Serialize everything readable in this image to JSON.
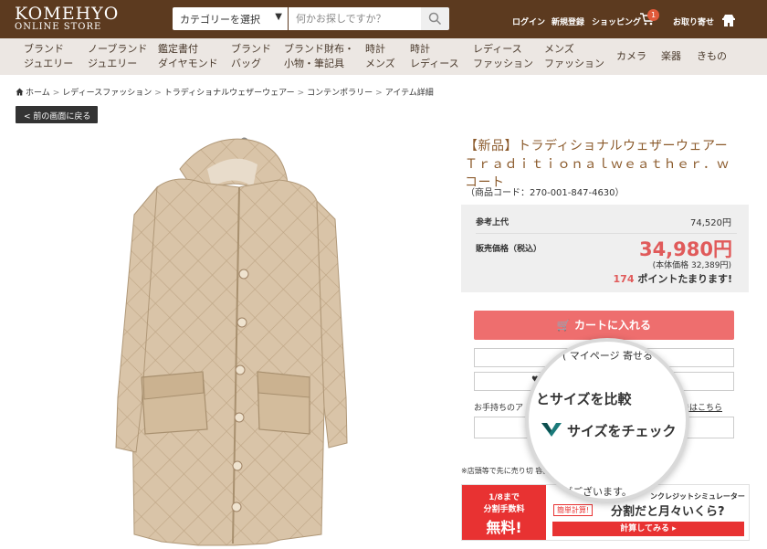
{
  "header": {
    "logo_line1": "KOMEHYO",
    "logo_line2": "ONLINE STORE",
    "category_select": "カテゴリーを選択",
    "search_placeholder": "何かお探しですか？",
    "login": "ログイン",
    "register": "新規登録",
    "shopping": "ショッピング",
    "cart_count": "1",
    "store_pickup": "お取り寄せ"
  },
  "category_nav": [
    {
      "line1": "ブランド",
      "line2": "ジュエリー"
    },
    {
      "line1": "ノーブランド",
      "line2": "ジュエリー"
    },
    {
      "line1": "鑑定書付",
      "line2": "ダイヤモンド"
    },
    {
      "line1": "ブランド",
      "line2": "バッグ"
    },
    {
      "line1": "ブランド財布・",
      "line2": "小物・筆記具"
    },
    {
      "line1": "時計",
      "line2": "メンズ"
    },
    {
      "line1": "時計",
      "line2": "レディース"
    },
    {
      "line1": "レディース",
      "line2": "ファッション"
    },
    {
      "line1": "メンズ",
      "line2": "ファッション"
    },
    {
      "line1": "カメラ",
      "line2": ""
    },
    {
      "line1": "楽器",
      "line2": ""
    },
    {
      "line1": "きもの",
      "line2": ""
    }
  ],
  "breadcrumb": [
    "ホーム",
    "レディースファッション",
    "トラディショナルウェザーウェアー",
    "コンテンポラリー",
    "アイテム詳細"
  ],
  "back_button": "< 前の画面に戻る",
  "product": {
    "title": "【新品】トラディショナルウェザーウェアー　Ｔｒａｄｉｔｉｏｎａｌｗｅａｔｈｅｒ．ｗ　コート",
    "code": "（商品コード：270-001-847-4630）",
    "ref_price_label": "参考上代",
    "ref_price": "74,520円",
    "sale_price_label": "販売価格（税込）",
    "sale_price": "34,980円",
    "tax_note": "(本体価格 32,389円)",
    "points_num": "174",
    "points_text": " ポイントたまります!",
    "cart_button": "カートに入れる",
    "favorite_button": "この   (マイページ)寄せる",
    "compare_heart": "♥",
    "owned_label": "お手持ちのア",
    "method_link": "方法はこちら",
    "note": "※店頭等で先に売り切                                                     容赦ください。"
  },
  "magnifier": {
    "top_line": "こ の   ( マイページ 寄せる",
    "compare": "とサイズを比較",
    "size_check": "サイズをチェック",
    "bottom_line": "合がございます。"
  },
  "banner": {
    "date": "1/8まで",
    "fee": "分割手数料",
    "free": "無料!",
    "simulator": "ンクレジットシミュレーター",
    "tag": "簡単計算!",
    "question": "分割だと月々いくら?",
    "button": "計算してみる"
  },
  "colors": {
    "header_bg": "#5c3a1f",
    "nav_bg": "#ece7e3",
    "accent_red": "#e05a5a",
    "cart_btn": "#ee6e6e",
    "title_brown": "#8b5a2b"
  }
}
